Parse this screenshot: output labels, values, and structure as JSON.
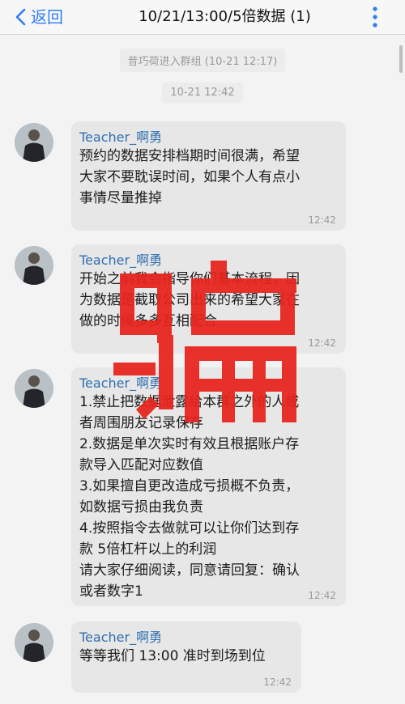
{
  "header": {
    "back_label": "返回",
    "title": "10/21/13:00/5倍数据 (1)"
  },
  "system": {
    "join_notice": "昔巧荷进入群组 (10-21 12:17)",
    "timestamp": "10-21 12:42"
  },
  "messages": [
    {
      "sender": "Teacher_啊勇",
      "lines": [
        "预约的数据安排档期时间很满，希望",
        "大家不要耽误时间，如果个人有点小",
        "事情尽量推掉"
      ],
      "time": "12:42"
    },
    {
      "sender": "Teacher_啊勇",
      "lines": [
        "开始之前我会指导你们基本流程，因",
        "为数据是截取公司出来的希望大家在",
        "做的时候多多互相配合"
      ],
      "time": "12:42"
    },
    {
      "sender": "Teacher_啊勇",
      "lines": [
        "1.禁止把数据泄露给本群之外的人或",
        "者周围朋友记录保存",
        "2.数据是单次实时有效且根据账户存",
        "款导入匹配对应数值",
        "3.如果擅自更改造成亏损概不负责，",
        "如数据亏损由我负责",
        "4.按照指令去做就可以让你们达到存",
        "款 5倍杠杆以上的利润",
        "请大家仔细阅读，同意请回复：确认",
        "或者数字1"
      ],
      "time": "12:42"
    },
    {
      "sender": "Teacher_啊勇",
      "lines": [
        "等等我们 13:00 准时到场到位"
      ],
      "time": "12:42"
    }
  ],
  "overlay": {
    "stamp_text": "骗",
    "stamp_color": "#e8231c"
  },
  "colors": {
    "accent": "#2f7df6",
    "sender": "#2f6fb0",
    "bubble": "#e7e7e7"
  }
}
